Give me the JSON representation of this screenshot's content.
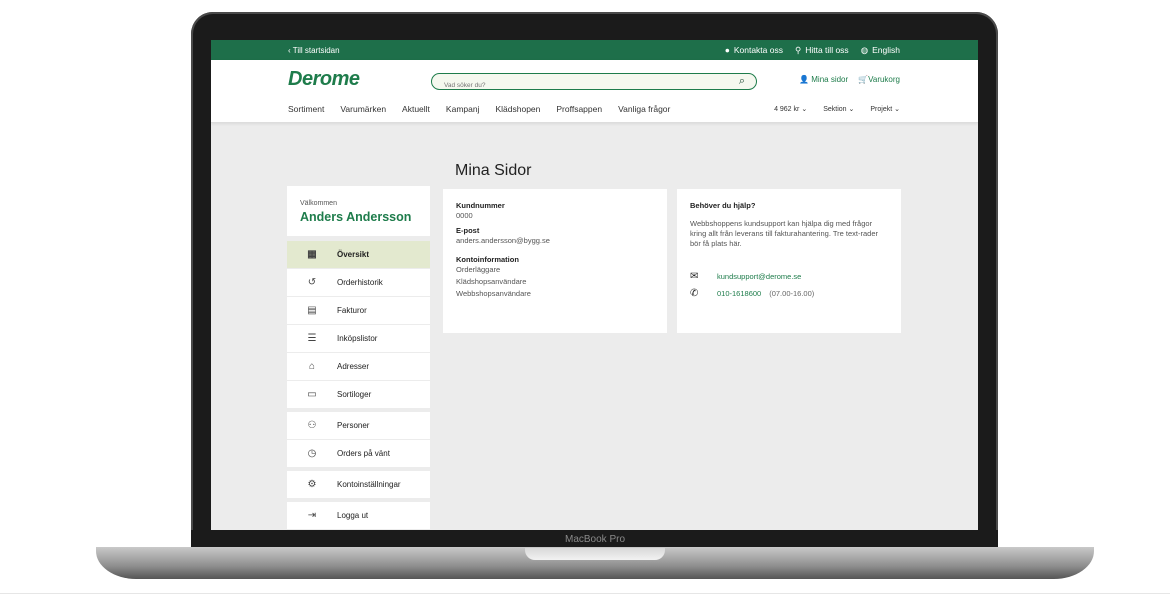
{
  "topbar": {
    "back": "Till startsidan",
    "contact": "Kontakta oss",
    "find": "Hitta till oss",
    "language": "English"
  },
  "header": {
    "logo": "Derome",
    "search_placeholder": "Vad söker du?",
    "my_pages": "Mina sidor",
    "cart": "Varukorg"
  },
  "nav": {
    "items": [
      "Sortiment",
      "Varumärken",
      "Aktuellt",
      "Kampanj",
      "Klädshopen",
      "Proffsappen",
      "Vanliga frågor"
    ],
    "price": "4 962 kr",
    "section": "Sektion",
    "project": "Projekt"
  },
  "page": {
    "title": "Mina Sidor"
  },
  "sidebar": {
    "welcome": "Välkommen",
    "name": "Anders Andersson",
    "items": [
      {
        "label": "Översikt",
        "icon": "grid-icon"
      },
      {
        "label": "Orderhistorik",
        "icon": "history-icon"
      },
      {
        "label": "Fakturor",
        "icon": "document-icon"
      },
      {
        "label": "Inköpslistor",
        "icon": "list-icon"
      },
      {
        "label": "Adresser",
        "icon": "building-icon"
      },
      {
        "label": "Sortiloger",
        "icon": "book-icon"
      },
      {
        "label": "Personer",
        "icon": "people-icon"
      },
      {
        "label": "Orders på vänt",
        "icon": "clipboard-clock-icon"
      },
      {
        "label": "Kontoinställningar",
        "icon": "gear-icon"
      },
      {
        "label": "Logga ut",
        "icon": "logout-icon"
      }
    ]
  },
  "account": {
    "customer_number_label": "Kundnummer",
    "customer_number": "0000",
    "email_label": "E-post",
    "email": "anders.andersson@bygg.se",
    "info_label": "Kontoinformation",
    "info_lines": [
      "Orderläggare",
      "Klädshopsanvändare",
      "Webbshopsanvändare"
    ]
  },
  "help": {
    "title": "Behöver du hjälp?",
    "text": "Webbshoppens kundsupport kan hjälpa dig med frågor kring allt från leverans till fakturahantering. Tre text-rader bör få plats här.",
    "email": "kundsupport@derome.se",
    "phone": "010-1618600",
    "hours": "(07.00-16.00)"
  },
  "device": {
    "label": "MacBook Pro"
  },
  "colors": {
    "brand_green": "#1e7c4b",
    "topbar": "#1e6f4a",
    "active": "#e3e9cf"
  }
}
